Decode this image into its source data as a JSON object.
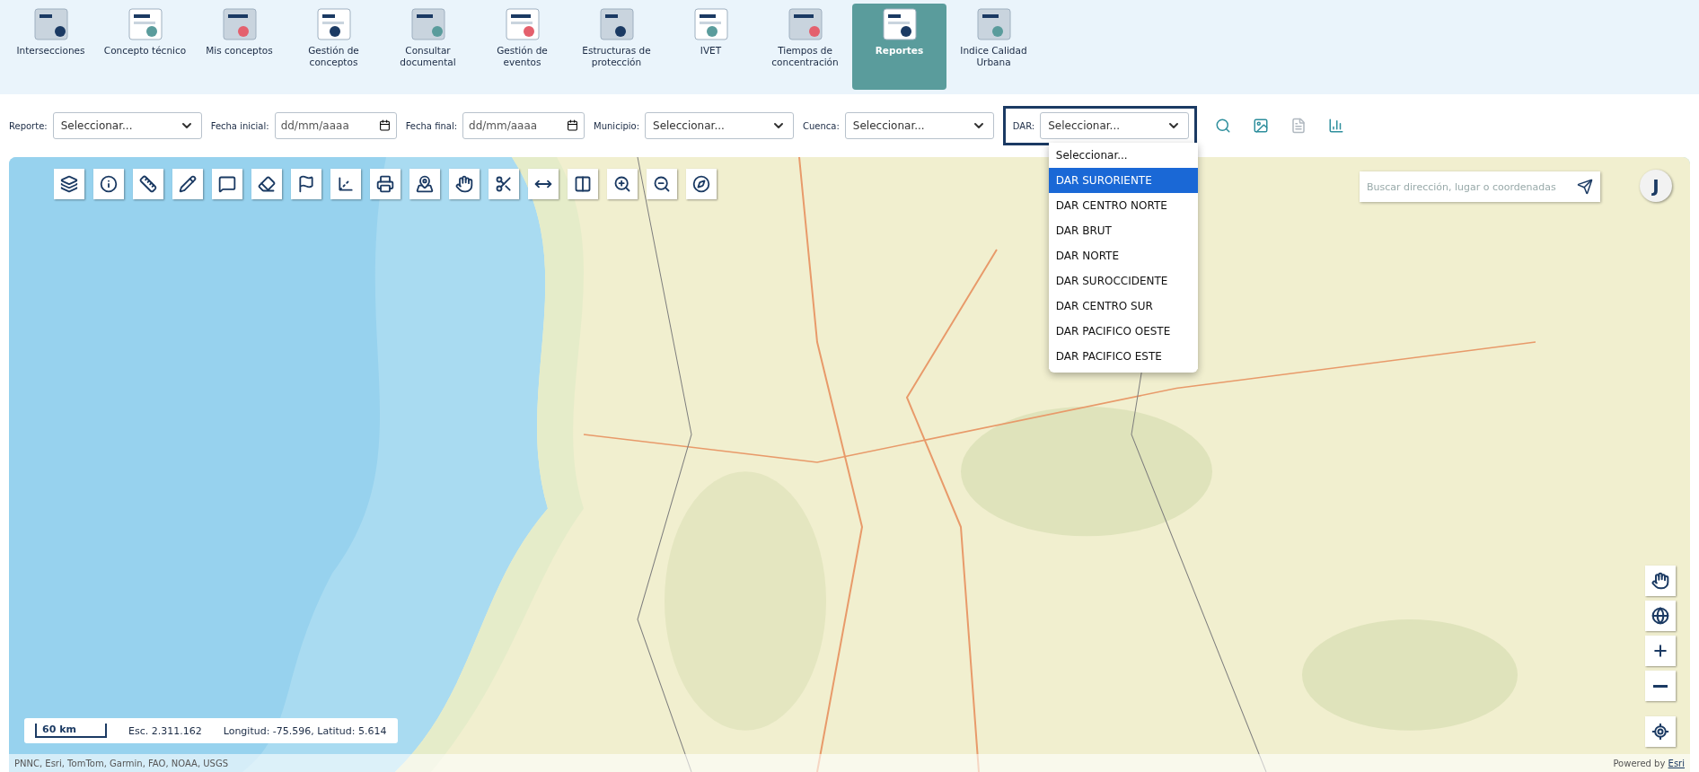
{
  "nav": {
    "items": [
      {
        "label": "Intersecciones",
        "selected": false
      },
      {
        "label": "Concepto técnico",
        "selected": false
      },
      {
        "label": "Mis conceptos",
        "selected": false
      },
      {
        "label": "Gestión de conceptos",
        "selected": false
      },
      {
        "label": "Consultar documental",
        "selected": false
      },
      {
        "label": "Gestión de eventos",
        "selected": false
      },
      {
        "label": "Estructuras de protección",
        "selected": false
      },
      {
        "label": "IVET",
        "selected": false
      },
      {
        "label": "Tiempos de concentración",
        "selected": false
      },
      {
        "label": "Reportes",
        "selected": true
      },
      {
        "label": "Indice Calidad Urbana",
        "selected": false
      }
    ]
  },
  "filters": [
    {
      "kind": "select",
      "label": "Reporte:",
      "value": "Seleccionar...",
      "highlighted": false
    },
    {
      "kind": "date",
      "label": "Fecha inicial:",
      "placeholder": "dd/mm/aaaa",
      "highlighted": false
    },
    {
      "kind": "date",
      "label": "Fecha final:",
      "placeholder": "dd/mm/aaaa",
      "highlighted": false
    },
    {
      "kind": "select",
      "label": "Municipio:",
      "value": "Seleccionar...",
      "highlighted": false
    },
    {
      "kind": "select",
      "label": "Cuenca:",
      "value": "Seleccionar...",
      "highlighted": false
    },
    {
      "kind": "select",
      "label": "DAR:",
      "value": "Seleccionar...",
      "highlighted": true
    }
  ],
  "dar_dropdown": {
    "options": [
      {
        "label": "Seleccionar...",
        "selected": false
      },
      {
        "label": "DAR SURORIENTE",
        "selected": true
      },
      {
        "label": "DAR CENTRO NORTE",
        "selected": false
      },
      {
        "label": "DAR BRUT",
        "selected": false
      },
      {
        "label": "DAR NORTE",
        "selected": false
      },
      {
        "label": "DAR SUROCCIDENTE",
        "selected": false
      },
      {
        "label": "DAR CENTRO SUR",
        "selected": false
      },
      {
        "label": "DAR PACIFICO OESTE",
        "selected": false
      },
      {
        "label": "DAR PACIFICO ESTE",
        "selected": false
      }
    ]
  },
  "filter_actions": [
    {
      "disabled": false
    },
    {
      "disabled": false
    },
    {
      "disabled": true
    },
    {
      "disabled": false
    }
  ],
  "search": {
    "placeholder": "Buscar dirección, lugar o coordenadas"
  },
  "user": {
    "initial": "J"
  },
  "scale": {
    "distance": "60 km",
    "scale": "Esc. 2.311.162",
    "coordinates": "Longitud: -75.596, Latitud: 5.614"
  },
  "attribution": "PNNC, Esri, TomTom, Garmin, FAO, NOAA, USGS",
  "powered_by": {
    "text": "Powered by",
    "link": "Esri"
  }
}
